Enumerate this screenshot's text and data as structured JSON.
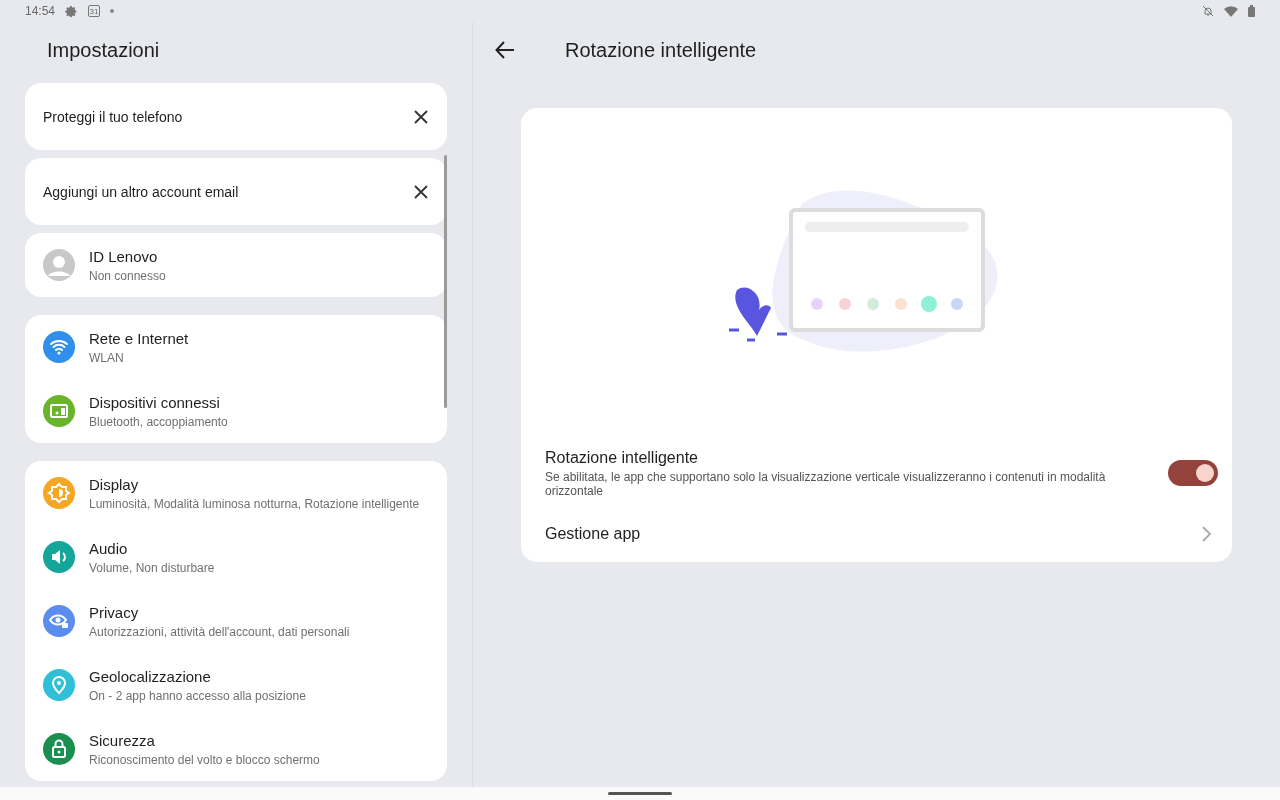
{
  "status_bar": {
    "time": "14:54",
    "calendar_day": "31"
  },
  "settings": {
    "title": "Impostazioni",
    "suggestions": [
      {
        "text": "Proteggi il tuo telefono"
      },
      {
        "text": "Aggiungi un altro account email"
      }
    ],
    "groups": [
      {
        "items": [
          {
            "kind": "account",
            "title": "ID Lenovo",
            "subtitle": "Non connesso",
            "color": "#c8c8c8"
          }
        ]
      },
      {
        "items": [
          {
            "kind": "wifi",
            "title": "Rete e Internet",
            "subtitle": "WLAN",
            "color": "#2f8fea"
          },
          {
            "kind": "devices",
            "title": "Dispositivi connessi",
            "subtitle": "Bluetooth, accoppiamento",
            "color": "#6ab42c"
          }
        ]
      },
      {
        "items": [
          {
            "kind": "display",
            "title": "Display",
            "subtitle": "Luminosità, Modalità luminosa notturna, Rotazione intelligente",
            "color": "#f5a623"
          },
          {
            "kind": "audio",
            "title": "Audio",
            "subtitle": "Volume, Non disturbare",
            "color": "#14a69a"
          },
          {
            "kind": "privacy",
            "title": "Privacy",
            "subtitle": "Autorizzazioni, attività dell'account, dati personali",
            "color": "#5b8def"
          },
          {
            "kind": "location",
            "title": "Geolocalizzazione",
            "subtitle": "On - 2 app hanno accesso alla posizione",
            "color": "#2fc0d8"
          },
          {
            "kind": "security",
            "title": "Sicurezza",
            "subtitle": "Riconoscimento del volto e blocco schermo",
            "color": "#1a8f4f"
          }
        ]
      }
    ]
  },
  "detail": {
    "title": "Rotazione intelligente",
    "toggle": {
      "title": "Rotazione intelligente",
      "description": "Se abilitata, le app che supportano solo la visualizzazione verticale visualizzeranno i contenuti in modalità orizzontale",
      "on": true
    },
    "link": {
      "label": "Gestione app"
    }
  }
}
